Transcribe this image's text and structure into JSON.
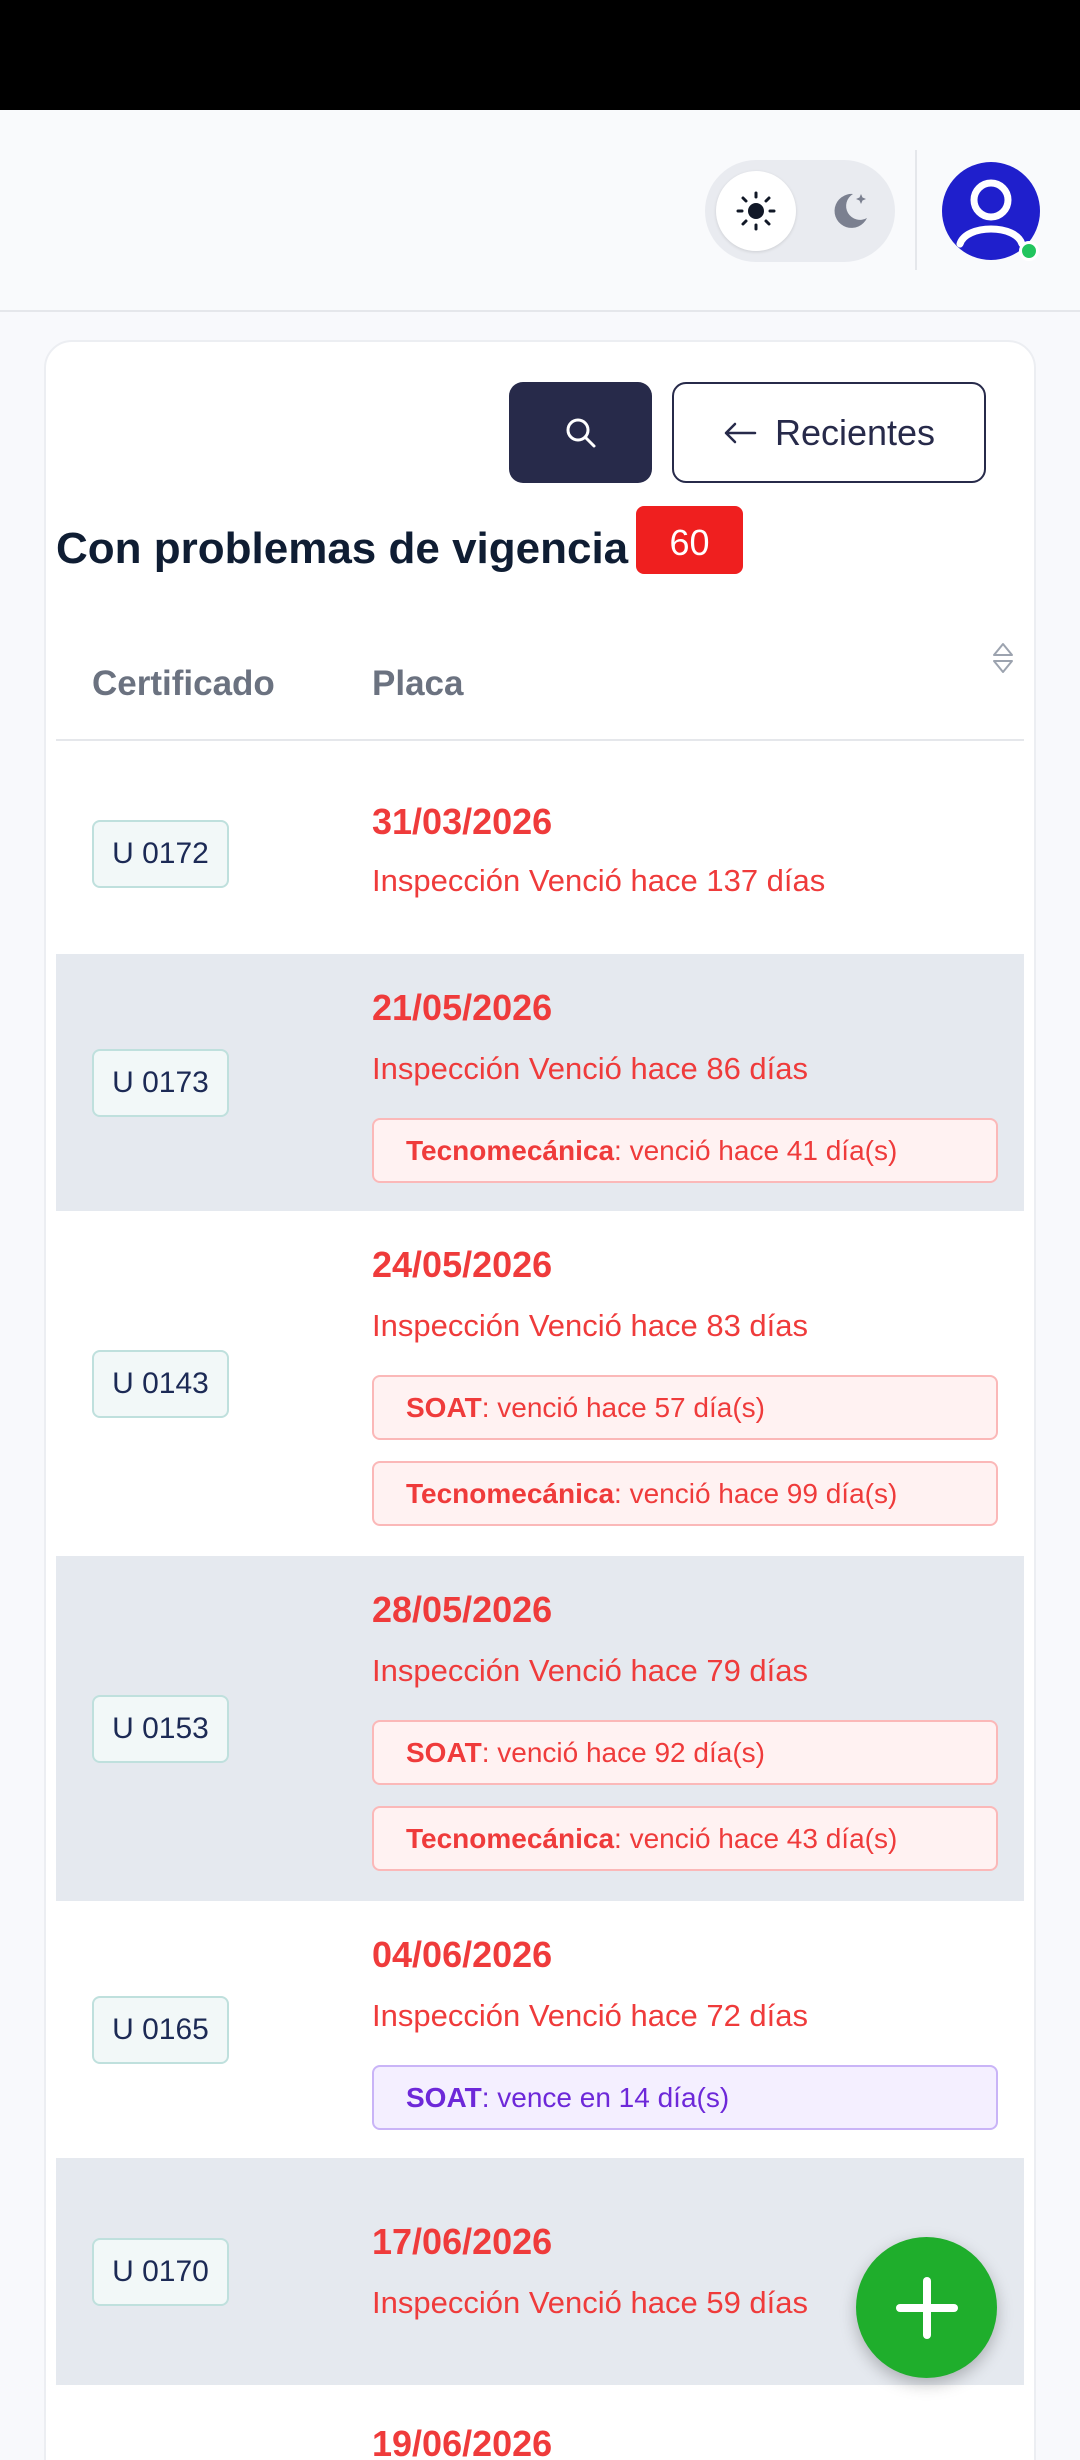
{
  "colors": {
    "primary_dark": "#272a4a",
    "danger": "#ef3b3b",
    "badge_red": "#ef1f1f",
    "purple": "#6d28d9",
    "fab_green": "#1fae2c",
    "avatar_blue": "#1f1fcc",
    "online_green": "#22c55e"
  },
  "header": {
    "theme_toggle": {
      "active": "light",
      "icons": [
        "sun-icon",
        "moon-icon"
      ]
    },
    "avatar_icon": "user-icon",
    "status": "online"
  },
  "toolbar": {
    "search_icon": "search-icon",
    "recent_label": "Recientes",
    "recent_icon": "arrow-left-icon"
  },
  "section": {
    "title": "Con problemas de vigencia",
    "count": "60"
  },
  "table": {
    "columns": [
      "Certificado",
      "Placa"
    ],
    "sort_icon": "sort-icon",
    "rows": [
      {
        "cert": "U 0172",
        "date": "31/03/2026",
        "inspection": "Inspección Venció hace 137 días",
        "alerts": []
      },
      {
        "cert": "U 0173",
        "date": "21/05/2026",
        "inspection": "Inspección Venció hace 86 días",
        "alerts": [
          {
            "kind": "Tecnomecánica",
            "text": ": venció hace 41 día(s)",
            "level": "expired"
          }
        ]
      },
      {
        "cert": "U 0143",
        "date": "24/05/2026",
        "inspection": "Inspección Venció hace 83 días",
        "alerts": [
          {
            "kind": "SOAT",
            "text": ": venció hace 57 día(s)",
            "level": "expired"
          },
          {
            "kind": "Tecnomecánica",
            "text": ": venció hace 99 día(s)",
            "level": "expired"
          }
        ]
      },
      {
        "cert": "U 0153",
        "date": "28/05/2026",
        "inspection": "Inspección Venció hace 79 días",
        "alerts": [
          {
            "kind": "SOAT",
            "text": ": venció hace 92 día(s)",
            "level": "expired"
          },
          {
            "kind": "Tecnomecánica",
            "text": ": venció hace 43 día(s)",
            "level": "expired"
          }
        ]
      },
      {
        "cert": "U 0165",
        "date": "04/06/2026",
        "inspection": "Inspección Venció hace 72 días",
        "alerts": [
          {
            "kind": "SOAT",
            "text": ": vence en 14 día(s)",
            "level": "upcoming"
          }
        ]
      },
      {
        "cert": "U 0170",
        "date": "17/06/2026",
        "inspection": "Inspección Venció hace 59 días",
        "alerts": []
      },
      {
        "cert": "",
        "date": "19/06/2026",
        "inspection": "",
        "alerts": []
      }
    ]
  },
  "fab": {
    "icon": "plus-icon"
  }
}
